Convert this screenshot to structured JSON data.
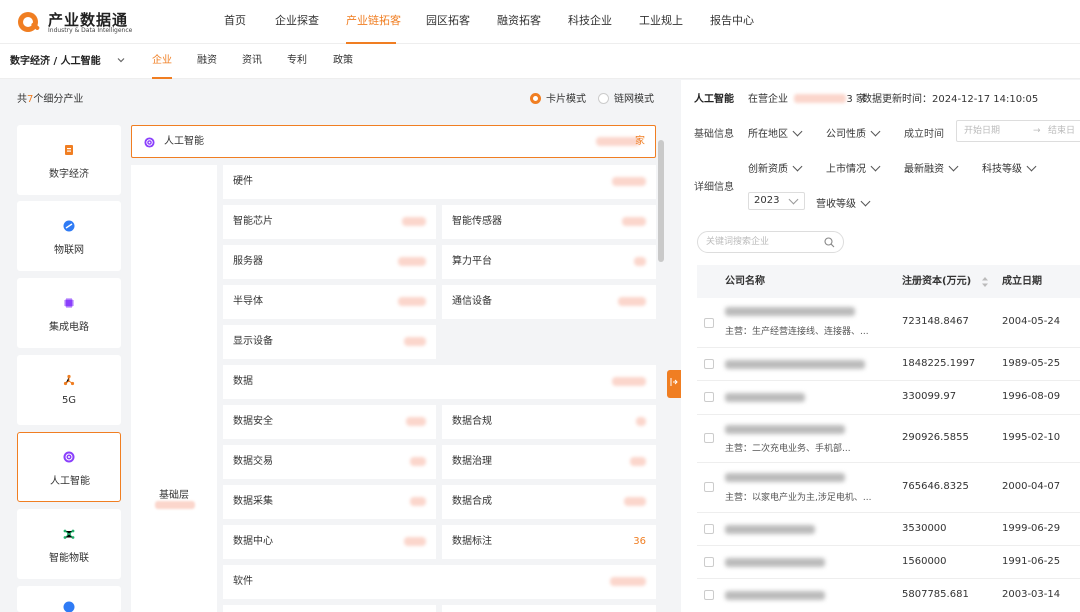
{
  "app": {
    "name": "产业数据通",
    "name_en": "Industry & Data Intelligence",
    "accent": "#f07e22"
  },
  "nav": [
    "首页",
    "企业探查",
    "产业链拓客",
    "园区拓客",
    "融资拓客",
    "科技企业",
    "工业规上",
    "报告中心"
  ],
  "nav_active": "产业链拓客",
  "subnav": {
    "breadcrumb": "数字经济 / 人工智能",
    "tabs": [
      "企业",
      "融资",
      "资讯",
      "专利",
      "政策"
    ],
    "active": "企业"
  },
  "left": {
    "count_prefix": "共",
    "count": "7",
    "count_suffix": "个细分产业",
    "modes": [
      {
        "label": "卡片模式",
        "selected": true
      },
      {
        "label": "链网模式",
        "selected": false
      }
    ],
    "industries": [
      {
        "label": "数字经济",
        "icon": "digital-economy-icon",
        "color": "#f07e22"
      },
      {
        "label": "物联网",
        "icon": "iot-icon",
        "color": "#2f7bf5"
      },
      {
        "label": "集成电路",
        "icon": "chip-icon",
        "color": "#8a3ffc"
      },
      {
        "label": "5G",
        "icon": "5g-icon",
        "color": "#f07e22"
      },
      {
        "label": "人工智能",
        "icon": "ai-icon",
        "color": "#8a3ffc",
        "active": true
      },
      {
        "label": "智能物联",
        "icon": "smart-iot-icon",
        "color": "#23b26d"
      }
    ],
    "chain_head": {
      "label": "人工智能",
      "value_suffix": "家"
    },
    "layer": {
      "label": "基础层"
    },
    "nodes": {
      "hardware": "硬件",
      "chip": "智能芯片",
      "sensor": "智能传感器",
      "server": "服务器",
      "computing": "算力平台",
      "semiconductor": "半导体",
      "comm": "通信设备",
      "display": "显示设备",
      "data": "数据",
      "data_security": "数据安全",
      "data_compliance": "数据合规",
      "data_trade": "数据交易",
      "data_governance": "数据治理",
      "data_collect": "数据采集",
      "data_synth": "数据合成",
      "data_center": "数据中心",
      "data_label": "数据标注",
      "data_label_value": "36",
      "software": "软件"
    }
  },
  "right": {
    "title": "人工智能",
    "status_prefix": "在营企业",
    "status_suffix": "3 家",
    "updated": "数据更新时间：2024-12-17 14:10:05",
    "basic_label": "基础信息",
    "detail_label": "详细信息",
    "filters_row1": [
      "所在地区",
      "公司性质"
    ],
    "established_label": "成立时间",
    "date_start": "开始日期",
    "date_arrow": "→",
    "date_end": "结束日",
    "filters_row2": [
      "创新资质",
      "上市情况",
      "最新融资",
      "科技等级"
    ],
    "year": "2023",
    "revenue_label": "营收等级",
    "search_placeholder": "关键词搜索企业",
    "columns": [
      "公司名称",
      "注册资本(万元)",
      "成立日期"
    ],
    "rows": [
      {
        "biz": "主营：生产经营连接线、连接器、...",
        "capital": "723148.8467",
        "date": "2004-05-24"
      },
      {
        "biz": "",
        "capital": "1848225.1997",
        "date": "1989-05-25"
      },
      {
        "biz": "",
        "capital": "330099.97",
        "date": "1996-08-09"
      },
      {
        "biz": "主营：二次充电业务、手机部...",
        "capital": "290926.5855",
        "date": "1995-02-10"
      },
      {
        "biz": "主营：以家电产业为主,涉足电机、...",
        "capital": "765646.8325",
        "date": "2000-04-07"
      },
      {
        "biz": "",
        "capital": "3530000",
        "date": "1999-06-29"
      },
      {
        "biz": "",
        "capital": "1560000",
        "date": "1991-06-25"
      },
      {
        "biz": "",
        "capital": "5807785.681",
        "date": "2003-03-14"
      }
    ]
  }
}
